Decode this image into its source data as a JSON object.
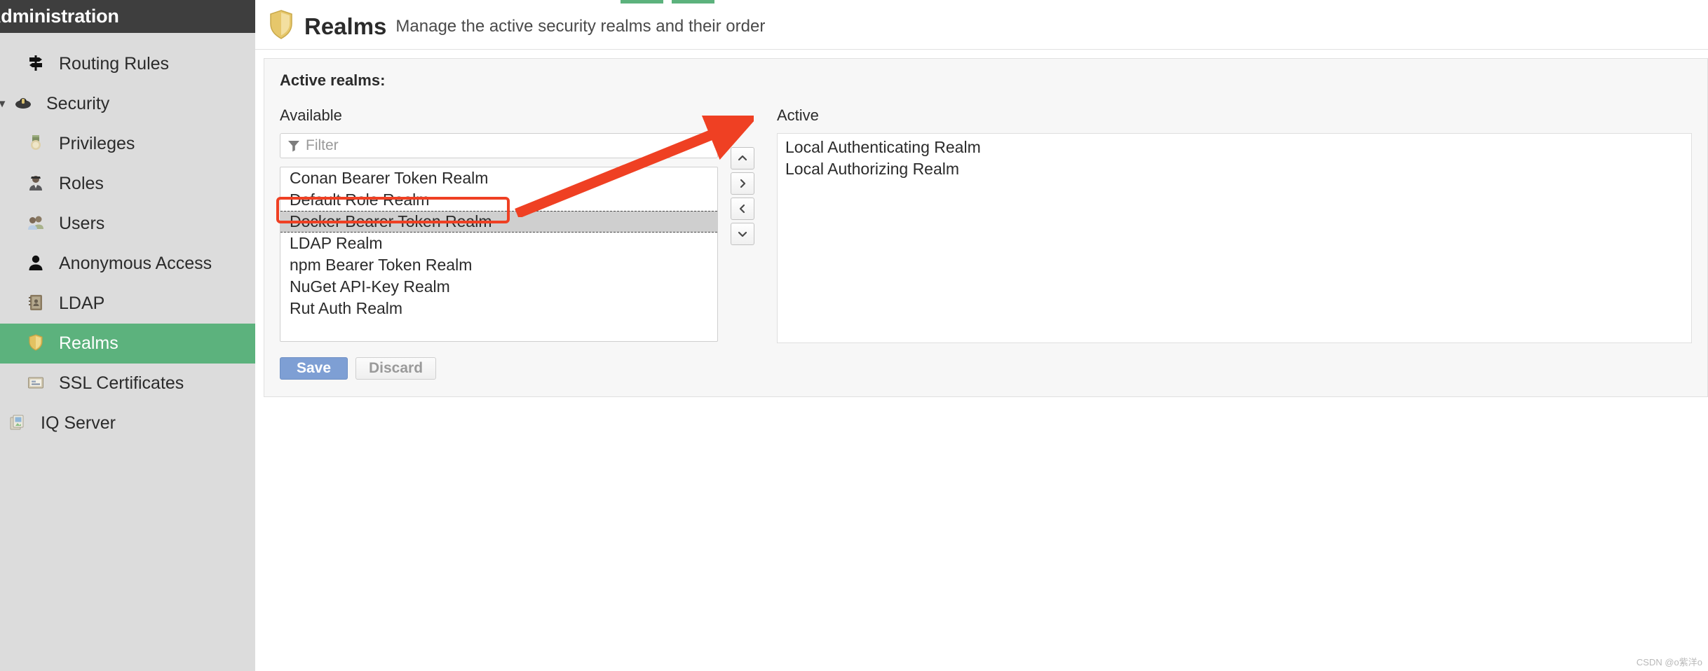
{
  "sidebar": {
    "header_title": "Administration",
    "items": [
      {
        "label": "Routing Rules",
        "icon": "signpost-icon",
        "glyph": "🚦",
        "level": "top",
        "selected": false,
        "caret": ""
      },
      {
        "label": "Security",
        "icon": "security-badge-icon",
        "glyph": "👮",
        "level": "group",
        "selected": false,
        "caret": "▼"
      },
      {
        "label": "Privileges",
        "icon": "medal-icon",
        "glyph": "🎖",
        "level": "child",
        "selected": false,
        "caret": ""
      },
      {
        "label": "Roles",
        "icon": "officer-icon",
        "glyph": "👮",
        "level": "child",
        "selected": false,
        "caret": ""
      },
      {
        "label": "Users",
        "icon": "users-icon",
        "glyph": "👥",
        "level": "child",
        "selected": false,
        "caret": ""
      },
      {
        "label": "Anonymous Access",
        "icon": "person-icon",
        "glyph": "👤",
        "level": "child",
        "selected": false,
        "caret": ""
      },
      {
        "label": "LDAP",
        "icon": "address-book-icon",
        "glyph": "📔",
        "level": "child",
        "selected": false,
        "caret": ""
      },
      {
        "label": "Realms",
        "icon": "shield-icon",
        "glyph": "🛡",
        "level": "child",
        "selected": true,
        "caret": ""
      },
      {
        "label": "SSL Certificates",
        "icon": "certificate-icon",
        "glyph": "💳",
        "level": "child",
        "selected": false,
        "caret": ""
      },
      {
        "label": "IQ Server",
        "icon": "iq-server-icon",
        "glyph": "🗂",
        "level": "top2",
        "selected": false,
        "caret": ""
      }
    ]
  },
  "header": {
    "icon": "shield-icon",
    "icon_glyph": "🛡",
    "title": "Realms",
    "subtitle": "Manage the active security realms and their order"
  },
  "panel": {
    "title": "Active realms:",
    "available_label": "Available",
    "active_label": "Active",
    "filter_placeholder": "Filter",
    "filter_value": "",
    "filter_icon": "funnel-icon",
    "available_items": [
      {
        "label": "Conan Bearer Token Realm",
        "selected": false
      },
      {
        "label": "Default Role Realm",
        "selected": false
      },
      {
        "label": "Docker Bearer Token Realm",
        "selected": true
      },
      {
        "label": "LDAP Realm",
        "selected": false
      },
      {
        "label": "npm Bearer Token Realm",
        "selected": false
      },
      {
        "label": "NuGet API-Key Realm",
        "selected": false
      },
      {
        "label": "Rut Auth Realm",
        "selected": false
      }
    ],
    "active_items": [
      {
        "label": "Local Authenticating Realm"
      },
      {
        "label": "Local Authorizing Realm"
      }
    ],
    "transfer_buttons": [
      {
        "icon": "chevron-up-icon",
        "name": "move-up-button"
      },
      {
        "icon": "chevron-right-icon",
        "name": "move-right-button"
      },
      {
        "icon": "chevron-left-icon",
        "name": "move-left-button"
      },
      {
        "icon": "chevron-down-icon",
        "name": "move-down-button"
      }
    ],
    "save_label": "Save",
    "discard_label": "Discard"
  },
  "annotation": {
    "highlight_color": "#ef4023",
    "arrow_color": "#ef4023"
  },
  "watermark": {
    "text": "CSDN @o紫洋o"
  },
  "colors": {
    "sidebar_bg": "#dcdcdc",
    "sidebar_header_bg": "#3e3e3e",
    "selected_green": "#5cb27d",
    "save_blue": "#7e9fd4",
    "selection_gray": "#cfcfcf"
  }
}
